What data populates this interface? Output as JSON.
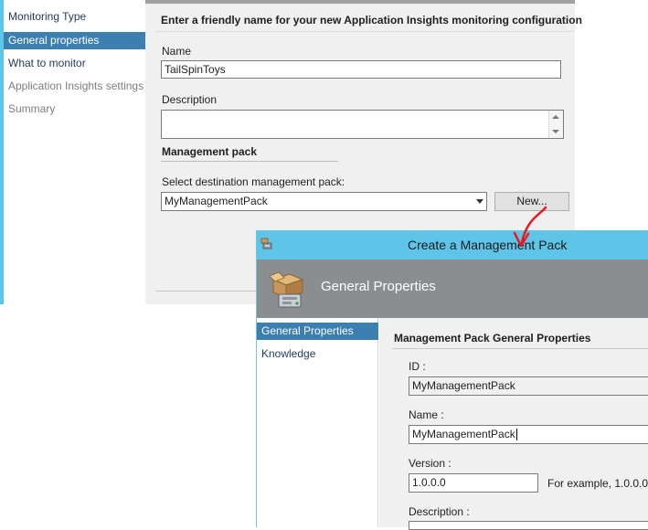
{
  "wizard": {
    "sidebar": {
      "items": [
        {
          "label": "Monitoring Type",
          "state": "normal"
        },
        {
          "label": "General properties",
          "state": "selected"
        },
        {
          "label": "What to monitor",
          "state": "normal"
        },
        {
          "label": "Application Insights settings",
          "state": "disabled"
        },
        {
          "label": "Summary",
          "state": "disabled"
        }
      ]
    },
    "header": "Enter a friendly name for your new Application Insights monitoring configuration",
    "name_label": "Name",
    "name_value": "TailSpinToys",
    "description_label": "Description",
    "description_value": "",
    "mp_section_title": "Management pack",
    "mp_select_label": "Select destination management pack:",
    "mp_selected": "MyManagementPack",
    "new_button": "New..."
  },
  "dialog": {
    "title": "Create a Management Pack",
    "banner_title": "General Properties",
    "nav": [
      {
        "label": "General Properties",
        "selected": true
      },
      {
        "label": "Knowledge",
        "selected": false
      }
    ],
    "section_title": "Management Pack General Properties",
    "id_label": "ID :",
    "id_value": "MyManagementPack",
    "name_label": "Name :",
    "name_value": "MyManagementPack",
    "version_label": "Version :",
    "version_value": "1.0.0.0",
    "version_hint": "For example, 1.0.0.0",
    "description_label": "Description :"
  },
  "colors": {
    "accent_bar": "#5ec5e8",
    "selection": "#3c7fb1",
    "annotation_arrow": "#e8191c"
  },
  "icons": [
    "management-pack-icon",
    "management-pack-banner-icon",
    "dropdown-arrow-icon",
    "scroll-up-icon",
    "scroll-down-icon"
  ]
}
